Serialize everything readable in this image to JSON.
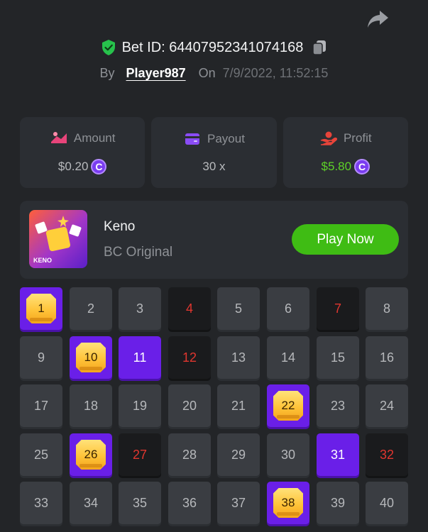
{
  "header": {
    "bet_label": "Bet ID:",
    "bet_id": "64407952341074168",
    "by_label": "By",
    "player": "Player987",
    "on_label": "On",
    "date": "7/9/2022, 11:52:15"
  },
  "stats": {
    "amount": {
      "label": "Amount",
      "value": "$0.20"
    },
    "payout": {
      "label": "Payout",
      "value": "30 x"
    },
    "profit": {
      "label": "Profit",
      "value": "$5.80"
    },
    "coin_symbol": "C"
  },
  "game": {
    "name": "Keno",
    "subtitle": "BC Original",
    "thumb_label": "KENO",
    "play_label": "Play Now"
  },
  "grid": {
    "numbers": [
      1,
      2,
      3,
      4,
      5,
      6,
      7,
      8,
      9,
      10,
      11,
      12,
      13,
      14,
      15,
      16,
      17,
      18,
      19,
      20,
      21,
      22,
      23,
      24,
      25,
      26,
      27,
      28,
      29,
      30,
      31,
      32,
      33,
      34,
      35,
      36,
      37,
      38,
      39,
      40
    ],
    "hits": [
      1,
      10,
      22,
      26,
      38
    ],
    "picked": [
      11,
      31
    ],
    "misses": [
      4,
      7,
      12,
      27,
      32
    ]
  },
  "colors": {
    "accent_purple": "#6a1fe8",
    "play_green": "#3fbc14",
    "profit_green": "#5ed128",
    "miss_red": "#e0362f"
  }
}
